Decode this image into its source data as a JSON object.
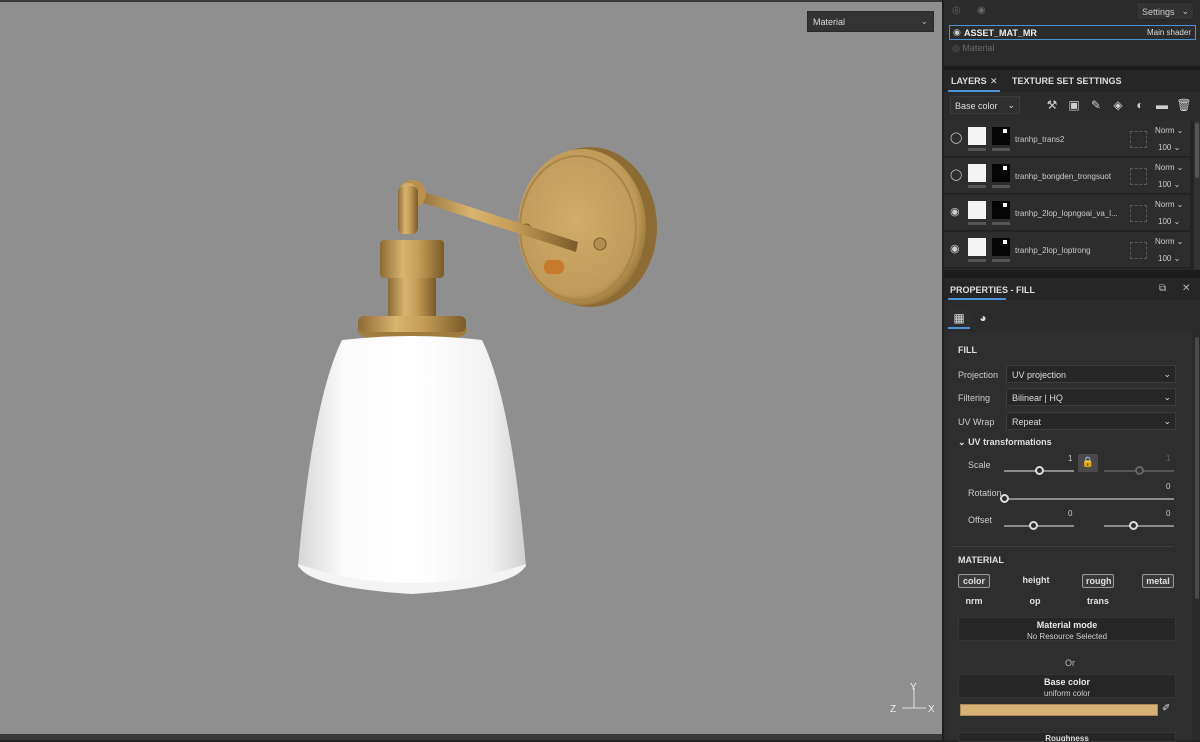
{
  "viewport": {
    "mode_select": "Material",
    "axis": {
      "x": "X",
      "y": "Y",
      "z": "Z"
    }
  },
  "texture_set": {
    "settings_label": "Settings",
    "name": "ASSET_MAT_MR",
    "shader": "Main shader",
    "material_label": "Material"
  },
  "tabs": {
    "layers": "LAYERS",
    "texture_set_settings": "TEXTURE SET SETTINGS"
  },
  "layer_toolbar": {
    "channel": "Base color"
  },
  "layers": [
    {
      "name": "tranhp_trans2",
      "blend": "Norm",
      "opacity": "100"
    },
    {
      "name": "tranhp_bongden_trongsuot",
      "blend": "Norm",
      "opacity": "100"
    },
    {
      "name": "tranhp_2lop_lopngoai_va_l...",
      "blend": "Norm",
      "opacity": "100"
    },
    {
      "name": "tranhp_2lop_loptrong",
      "blend": "Norm",
      "opacity": "100"
    }
  ],
  "properties": {
    "title": "PROPERTIES - FILL",
    "fill_section": "FILL",
    "projection_label": "Projection",
    "projection_value": "UV projection",
    "filtering_label": "Filtering",
    "filtering_value": "Bilinear | HQ",
    "uvwrap_label": "UV Wrap",
    "uvwrap_value": "Repeat",
    "uv_transformations": "UV transformations",
    "scale_label": "Scale",
    "scale_value": "1",
    "scale_value_2": "1",
    "rotation_label": "Rotation",
    "rotation_value": "0",
    "offset_label": "Offset",
    "offset_u": "0",
    "offset_v": "0",
    "material_section": "MATERIAL",
    "channels": [
      {
        "label": "color",
        "active": true
      },
      {
        "label": "height",
        "active": false
      },
      {
        "label": "rough",
        "active": true
      },
      {
        "label": "metal",
        "active": true
      },
      {
        "label": "nrm",
        "active": false
      },
      {
        "label": "op",
        "active": false
      },
      {
        "label": "trans",
        "active": false
      }
    ],
    "material_mode_title": "Material mode",
    "material_mode_value": "No Resource Selected",
    "or_label": "Or",
    "base_color_title": "Base color",
    "base_color_value": "uniform color",
    "base_color_hex": "#d7b176",
    "roughness_title": "Roughness"
  }
}
